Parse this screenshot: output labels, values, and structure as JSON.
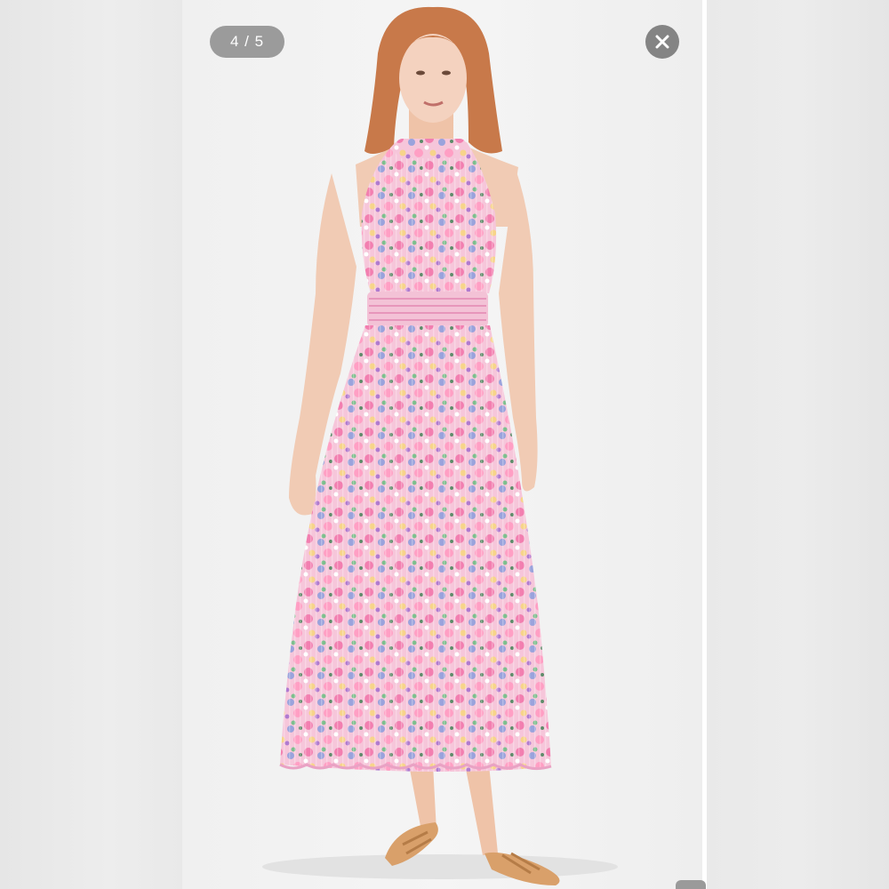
{
  "viewer": {
    "counter": "4 / 5",
    "close_icon": "close-icon",
    "photo_subject": "floral-pleated-halter-maxi-dress-photo"
  },
  "colors": {
    "background": "#ebebeb",
    "stage": "#f2f2f2",
    "counter_pill": "#8c8c8c",
    "close_button": "#787878",
    "dress_pink": "#f28ab8",
    "dress_blue": "#8c9ad8",
    "skin": "#f1cbb4",
    "hair": "#c8794a"
  }
}
